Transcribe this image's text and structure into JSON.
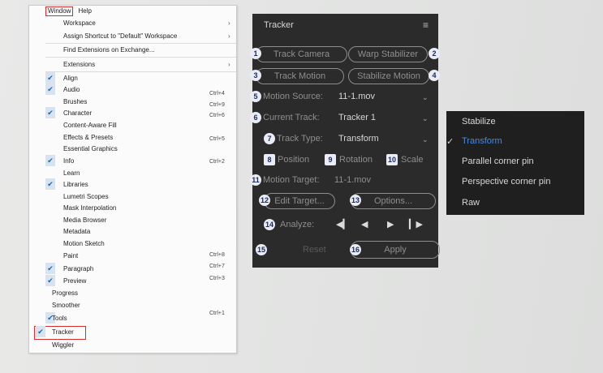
{
  "menubar": {
    "window": "Window",
    "help": "Help"
  },
  "menu_items": [
    {
      "label": "Workspace",
      "shortcut": "",
      "submenu": true,
      "checked": false
    },
    {
      "label": "Assign Shortcut to \"Default\" Workspace",
      "shortcut": "",
      "submenu": true,
      "checked": false
    },
    {
      "label": "Find Extensions on Exchange...",
      "shortcut": "",
      "submenu": false,
      "checked": false
    },
    {
      "label": "Extensions",
      "shortcut": "",
      "submenu": true,
      "checked": false
    },
    {
      "label": "Align",
      "shortcut": "",
      "submenu": false,
      "checked": true
    },
    {
      "label": "Audio",
      "shortcut": "Ctrl+4",
      "submenu": false,
      "checked": true
    },
    {
      "label": "Brushes",
      "shortcut": "Ctrl+9",
      "submenu": false,
      "checked": false
    },
    {
      "label": "Character",
      "shortcut": "Ctrl+6",
      "submenu": false,
      "checked": true
    },
    {
      "label": "Content-Aware Fill",
      "shortcut": "",
      "submenu": false,
      "checked": false
    },
    {
      "label": "Effects & Presets",
      "shortcut": "Ctrl+5",
      "submenu": false,
      "checked": false
    },
    {
      "label": "Essential Graphics",
      "shortcut": "",
      "submenu": false,
      "checked": false
    },
    {
      "label": "Info",
      "shortcut": "Ctrl+2",
      "submenu": false,
      "checked": true
    },
    {
      "label": "Learn",
      "shortcut": "",
      "submenu": false,
      "checked": false
    },
    {
      "label": "Libraries",
      "shortcut": "",
      "submenu": false,
      "checked": true
    },
    {
      "label": "Lumetri Scopes",
      "shortcut": "",
      "submenu": false,
      "checked": false
    },
    {
      "label": "Mask Interpolation",
      "shortcut": "",
      "submenu": false,
      "checked": false
    },
    {
      "label": "Media Browser",
      "shortcut": "",
      "submenu": false,
      "checked": false
    },
    {
      "label": "Metadata",
      "shortcut": "",
      "submenu": false,
      "checked": false
    },
    {
      "label": "Motion Sketch",
      "shortcut": "",
      "submenu": false,
      "checked": false
    },
    {
      "label": "Paint",
      "shortcut": "Ctrl+8",
      "submenu": false,
      "checked": false
    },
    {
      "label": "Paragraph",
      "shortcut": "Ctrl+7",
      "submenu": false,
      "checked": true
    },
    {
      "label": "Preview",
      "shortcut": "Ctrl+3",
      "submenu": false,
      "checked": true
    },
    {
      "label": "Progress",
      "shortcut": "",
      "submenu": false,
      "checked": false
    },
    {
      "label": "Smoother",
      "shortcut": "",
      "submenu": false,
      "checked": false
    },
    {
      "label": "Tools",
      "shortcut": "Ctrl+1",
      "submenu": false,
      "checked": true
    },
    {
      "label": "Tracker",
      "shortcut": "",
      "submenu": false,
      "checked": true
    },
    {
      "label": "Wiggler",
      "shortcut": "",
      "submenu": false,
      "checked": false
    }
  ],
  "tracker": {
    "title": "Tracker",
    "menu_icon": "hamburger-icon",
    "track_camera": "Track Camera",
    "warp_stabilizer": "Warp Stabilizer",
    "track_motion": "Track Motion",
    "stabilize_motion": "Stabilize Motion",
    "motion_source_label": "Motion Source:",
    "motion_source_value": "11-1.mov",
    "current_track_label": "Current Track:",
    "current_track_value": "Tracker 1",
    "track_type_label": "Track Type:",
    "track_type_value": "Transform",
    "position": "Position",
    "rotation": "Rotation",
    "scale": "Scale",
    "motion_target_label": "Motion Target:",
    "motion_target_value": "11-1.mov",
    "edit_target": "Edit Target...",
    "options": "Options...",
    "analyze_label": "Analyze:",
    "reset": "Reset",
    "apply": "Apply"
  },
  "badges": [
    "1",
    "2",
    "3",
    "4",
    "5",
    "6",
    "7",
    "8",
    "9",
    "10",
    "11",
    "12",
    "13",
    "14",
    "15",
    "16"
  ],
  "track_type_options": [
    {
      "label": "Stabilize",
      "selected": false
    },
    {
      "label": "Transform",
      "selected": true
    },
    {
      "label": "Parallel corner pin",
      "selected": false
    },
    {
      "label": "Perspective corner pin",
      "selected": false
    },
    {
      "label": "Raw",
      "selected": false
    }
  ],
  "colors": {
    "panel_bg": "#2b2b2b",
    "highlight_red": "#d32f2f",
    "check_blue": "#1565c0",
    "selected_blue": "#4a89dc"
  }
}
